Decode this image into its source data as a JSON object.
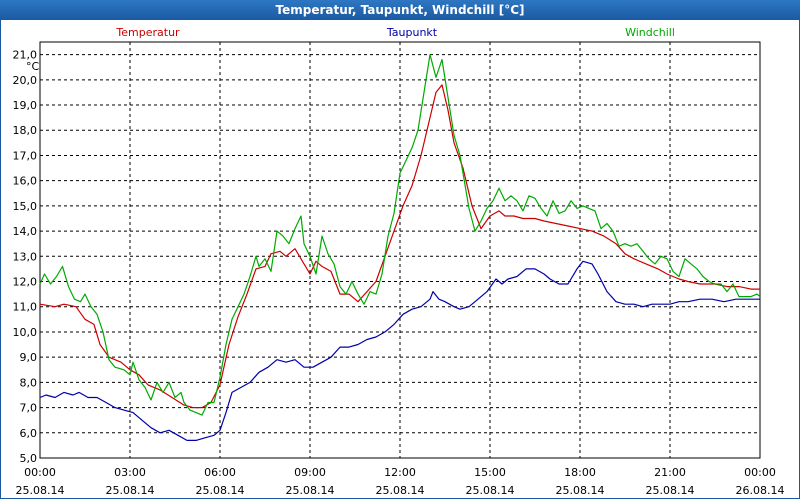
{
  "window": {
    "title": "Temperatur, Taupunkt, Windchill [°C]"
  },
  "chart_data": {
    "type": "line",
    "ylabel": "°C",
    "ylim": [
      5.0,
      21.5
    ],
    "yticks": [
      5.0,
      6.0,
      7.0,
      8.0,
      9.0,
      10.0,
      11.0,
      12.0,
      13.0,
      14.0,
      15.0,
      16.0,
      17.0,
      18.0,
      19.0,
      20.0,
      21.0
    ],
    "xlim_hours": [
      0,
      24
    ],
    "xticks": [
      {
        "h": 0,
        "time": "00:00",
        "date": "25.08.14"
      },
      {
        "h": 3,
        "time": "03:00",
        "date": "25.08.14"
      },
      {
        "h": 6,
        "time": "06:00",
        "date": "25.08.14"
      },
      {
        "h": 9,
        "time": "09:00",
        "date": "25.08.14"
      },
      {
        "h": 12,
        "time": "12:00",
        "date": "25.08.14"
      },
      {
        "h": 15,
        "time": "15:00",
        "date": "25.08.14"
      },
      {
        "h": 18,
        "time": "18:00",
        "date": "25.08.14"
      },
      {
        "h": 21,
        "time": "21:00",
        "date": "25.08.14"
      },
      {
        "h": 24,
        "time": "00:00",
        "date": "26.08.14"
      }
    ],
    "grid": true,
    "series": [
      {
        "name": "Temperatur",
        "color": "#cc0000",
        "points": [
          [
            0,
            11.1
          ],
          [
            0.5,
            11.0
          ],
          [
            0.8,
            11.1
          ],
          [
            1.2,
            11.0
          ],
          [
            1.5,
            10.5
          ],
          [
            1.8,
            10.3
          ],
          [
            2.0,
            9.5
          ],
          [
            2.3,
            9.0
          ],
          [
            2.7,
            8.8
          ],
          [
            3.0,
            8.5
          ],
          [
            3.3,
            8.3
          ],
          [
            3.6,
            7.9
          ],
          [
            4.0,
            7.7
          ],
          [
            4.4,
            7.4
          ],
          [
            4.8,
            7.1
          ],
          [
            5.1,
            7.0
          ],
          [
            5.4,
            7.0
          ],
          [
            5.7,
            7.2
          ],
          [
            6.0,
            7.9
          ],
          [
            6.3,
            9.5
          ],
          [
            6.6,
            10.6
          ],
          [
            6.9,
            11.5
          ],
          [
            7.2,
            12.5
          ],
          [
            7.5,
            12.6
          ],
          [
            7.7,
            13.1
          ],
          [
            8.0,
            13.2
          ],
          [
            8.2,
            13.0
          ],
          [
            8.5,
            13.3
          ],
          [
            8.7,
            12.9
          ],
          [
            9.0,
            12.3
          ],
          [
            9.2,
            12.8
          ],
          [
            9.4,
            12.6
          ],
          [
            9.7,
            12.4
          ],
          [
            10.0,
            11.5
          ],
          [
            10.3,
            11.5
          ],
          [
            10.6,
            11.2
          ],
          [
            10.9,
            11.6
          ],
          [
            11.2,
            12.0
          ],
          [
            11.5,
            13.0
          ],
          [
            11.8,
            14.0
          ],
          [
            12.1,
            15.0
          ],
          [
            12.4,
            15.8
          ],
          [
            12.7,
            17.0
          ],
          [
            13.0,
            18.5
          ],
          [
            13.2,
            19.5
          ],
          [
            13.4,
            19.8
          ],
          [
            13.6,
            18.8
          ],
          [
            13.8,
            17.5
          ],
          [
            14.1,
            16.5
          ],
          [
            14.4,
            15.0
          ],
          [
            14.7,
            14.1
          ],
          [
            15.0,
            14.6
          ],
          [
            15.3,
            14.8
          ],
          [
            15.5,
            14.6
          ],
          [
            15.8,
            14.6
          ],
          [
            16.1,
            14.5
          ],
          [
            16.5,
            14.5
          ],
          [
            16.8,
            14.4
          ],
          [
            17.2,
            14.3
          ],
          [
            17.6,
            14.2
          ],
          [
            18.0,
            14.1
          ],
          [
            18.4,
            14.0
          ],
          [
            18.8,
            13.8
          ],
          [
            19.2,
            13.5
          ],
          [
            19.5,
            13.1
          ],
          [
            19.8,
            12.9
          ],
          [
            20.2,
            12.7
          ],
          [
            20.6,
            12.5
          ],
          [
            20.9,
            12.3
          ],
          [
            21.3,
            12.1
          ],
          [
            21.6,
            12.0
          ],
          [
            22.0,
            11.9
          ],
          [
            22.5,
            11.9
          ],
          [
            22.9,
            11.8
          ],
          [
            23.3,
            11.8
          ],
          [
            23.7,
            11.7
          ],
          [
            24.0,
            11.7
          ]
        ]
      },
      {
        "name": "Taupunkt",
        "color": "#0000aa",
        "points": [
          [
            0,
            7.4
          ],
          [
            0.2,
            7.5
          ],
          [
            0.5,
            7.4
          ],
          [
            0.8,
            7.6
          ],
          [
            1.1,
            7.5
          ],
          [
            1.3,
            7.6
          ],
          [
            1.6,
            7.4
          ],
          [
            1.9,
            7.4
          ],
          [
            2.2,
            7.2
          ],
          [
            2.5,
            7.0
          ],
          [
            2.8,
            6.9
          ],
          [
            3.1,
            6.8
          ],
          [
            3.4,
            6.5
          ],
          [
            3.7,
            6.2
          ],
          [
            4.0,
            6.0
          ],
          [
            4.3,
            6.1
          ],
          [
            4.6,
            5.9
          ],
          [
            4.9,
            5.7
          ],
          [
            5.2,
            5.7
          ],
          [
            5.5,
            5.8
          ],
          [
            5.8,
            5.9
          ],
          [
            6.0,
            6.1
          ],
          [
            6.2,
            6.8
          ],
          [
            6.4,
            7.6
          ],
          [
            6.7,
            7.8
          ],
          [
            7.0,
            8.0
          ],
          [
            7.3,
            8.4
          ],
          [
            7.6,
            8.6
          ],
          [
            7.9,
            8.9
          ],
          [
            8.2,
            8.8
          ],
          [
            8.5,
            8.9
          ],
          [
            8.8,
            8.6
          ],
          [
            9.1,
            8.6
          ],
          [
            9.4,
            8.8
          ],
          [
            9.7,
            9.0
          ],
          [
            10.0,
            9.4
          ],
          [
            10.3,
            9.4
          ],
          [
            10.6,
            9.5
          ],
          [
            10.9,
            9.7
          ],
          [
            11.2,
            9.8
          ],
          [
            11.5,
            10.0
          ],
          [
            11.8,
            10.3
          ],
          [
            12.1,
            10.7
          ],
          [
            12.4,
            10.9
          ],
          [
            12.7,
            11.0
          ],
          [
            13.0,
            11.3
          ],
          [
            13.1,
            11.6
          ],
          [
            13.3,
            11.3
          ],
          [
            13.5,
            11.2
          ],
          [
            13.8,
            11.0
          ],
          [
            14.0,
            10.9
          ],
          [
            14.3,
            11.0
          ],
          [
            14.6,
            11.3
          ],
          [
            14.9,
            11.6
          ],
          [
            15.2,
            12.1
          ],
          [
            15.4,
            11.9
          ],
          [
            15.6,
            12.1
          ],
          [
            15.9,
            12.2
          ],
          [
            16.2,
            12.5
          ],
          [
            16.5,
            12.5
          ],
          [
            16.8,
            12.3
          ],
          [
            17.0,
            12.1
          ],
          [
            17.3,
            11.9
          ],
          [
            17.6,
            11.9
          ],
          [
            17.9,
            12.5
          ],
          [
            18.1,
            12.8
          ],
          [
            18.4,
            12.7
          ],
          [
            18.6,
            12.3
          ],
          [
            18.9,
            11.6
          ],
          [
            19.2,
            11.2
          ],
          [
            19.5,
            11.1
          ],
          [
            19.8,
            11.1
          ],
          [
            20.1,
            11.0
          ],
          [
            20.4,
            11.1
          ],
          [
            20.7,
            11.1
          ],
          [
            21.0,
            11.1
          ],
          [
            21.3,
            11.2
          ],
          [
            21.6,
            11.2
          ],
          [
            22.0,
            11.3
          ],
          [
            22.4,
            11.3
          ],
          [
            22.8,
            11.2
          ],
          [
            23.2,
            11.3
          ],
          [
            23.6,
            11.3
          ],
          [
            24.0,
            11.3
          ]
        ]
      },
      {
        "name": "Windchill",
        "color": "#00aa00",
        "points": [
          [
            0,
            11.9
          ],
          [
            0.15,
            12.3
          ],
          [
            0.35,
            11.9
          ],
          [
            0.55,
            12.2
          ],
          [
            0.75,
            12.6
          ],
          [
            0.95,
            11.8
          ],
          [
            1.15,
            11.3
          ],
          [
            1.35,
            11.2
          ],
          [
            1.5,
            11.5
          ],
          [
            1.7,
            11.0
          ],
          [
            1.9,
            10.7
          ],
          [
            2.1,
            10.0
          ],
          [
            2.3,
            8.9
          ],
          [
            2.5,
            8.6
          ],
          [
            2.8,
            8.5
          ],
          [
            3.0,
            8.3
          ],
          [
            3.1,
            8.8
          ],
          [
            3.3,
            8.1
          ],
          [
            3.5,
            7.8
          ],
          [
            3.7,
            7.3
          ],
          [
            3.9,
            8.0
          ],
          [
            4.1,
            7.6
          ],
          [
            4.3,
            8.0
          ],
          [
            4.5,
            7.4
          ],
          [
            4.7,
            7.6
          ],
          [
            4.8,
            7.2
          ],
          [
            5.0,
            6.9
          ],
          [
            5.2,
            6.8
          ],
          [
            5.4,
            6.7
          ],
          [
            5.6,
            7.2
          ],
          [
            5.8,
            7.2
          ],
          [
            6.0,
            8.2
          ],
          [
            6.2,
            9.5
          ],
          [
            6.4,
            10.5
          ],
          [
            6.6,
            11.0
          ],
          [
            6.8,
            11.5
          ],
          [
            7.0,
            12.2
          ],
          [
            7.2,
            13.0
          ],
          [
            7.3,
            12.6
          ],
          [
            7.5,
            12.9
          ],
          [
            7.7,
            12.4
          ],
          [
            7.9,
            14.0
          ],
          [
            8.1,
            13.8
          ],
          [
            8.3,
            13.5
          ],
          [
            8.5,
            14.1
          ],
          [
            8.7,
            14.6
          ],
          [
            8.8,
            13.5
          ],
          [
            9.0,
            13.0
          ],
          [
            9.2,
            12.3
          ],
          [
            9.4,
            13.8
          ],
          [
            9.6,
            13.1
          ],
          [
            9.8,
            12.7
          ],
          [
            10.0,
            11.8
          ],
          [
            10.2,
            11.5
          ],
          [
            10.4,
            12.0
          ],
          [
            10.6,
            11.5
          ],
          [
            10.8,
            11.1
          ],
          [
            11.0,
            11.6
          ],
          [
            11.2,
            11.5
          ],
          [
            11.4,
            12.3
          ],
          [
            11.6,
            13.8
          ],
          [
            11.8,
            14.7
          ],
          [
            12.0,
            16.3
          ],
          [
            12.2,
            16.8
          ],
          [
            12.4,
            17.3
          ],
          [
            12.6,
            18.0
          ],
          [
            12.8,
            19.5
          ],
          [
            13.0,
            21.0
          ],
          [
            13.2,
            20.1
          ],
          [
            13.4,
            20.8
          ],
          [
            13.6,
            19.3
          ],
          [
            13.8,
            17.8
          ],
          [
            14.0,
            17.0
          ],
          [
            14.3,
            14.9
          ],
          [
            14.5,
            14.0
          ],
          [
            14.7,
            14.4
          ],
          [
            14.9,
            14.9
          ],
          [
            15.1,
            15.2
          ],
          [
            15.3,
            15.7
          ],
          [
            15.5,
            15.2
          ],
          [
            15.7,
            15.4
          ],
          [
            15.9,
            15.2
          ],
          [
            16.1,
            14.8
          ],
          [
            16.3,
            15.4
          ],
          [
            16.5,
            15.3
          ],
          [
            16.7,
            14.9
          ],
          [
            16.9,
            14.6
          ],
          [
            17.1,
            15.2
          ],
          [
            17.3,
            14.7
          ],
          [
            17.5,
            14.8
          ],
          [
            17.7,
            15.2
          ],
          [
            17.9,
            14.9
          ],
          [
            18.1,
            15.0
          ],
          [
            18.3,
            14.9
          ],
          [
            18.5,
            14.8
          ],
          [
            18.7,
            14.1
          ],
          [
            18.9,
            14.3
          ],
          [
            19.1,
            14.0
          ],
          [
            19.3,
            13.4
          ],
          [
            19.5,
            13.5
          ],
          [
            19.7,
            13.4
          ],
          [
            19.9,
            13.5
          ],
          [
            20.1,
            13.2
          ],
          [
            20.3,
            12.9
          ],
          [
            20.5,
            12.7
          ],
          [
            20.7,
            13.0
          ],
          [
            20.9,
            12.9
          ],
          [
            21.1,
            12.4
          ],
          [
            21.3,
            12.2
          ],
          [
            21.5,
            12.9
          ],
          [
            21.7,
            12.7
          ],
          [
            21.9,
            12.5
          ],
          [
            22.1,
            12.2
          ],
          [
            22.3,
            12.0
          ],
          [
            22.5,
            11.9
          ],
          [
            22.7,
            11.9
          ],
          [
            22.9,
            11.6
          ],
          [
            23.1,
            11.9
          ],
          [
            23.3,
            11.4
          ],
          [
            23.5,
            11.4
          ],
          [
            23.7,
            11.4
          ],
          [
            23.9,
            11.5
          ],
          [
            24.0,
            11.4
          ]
        ]
      }
    ]
  }
}
